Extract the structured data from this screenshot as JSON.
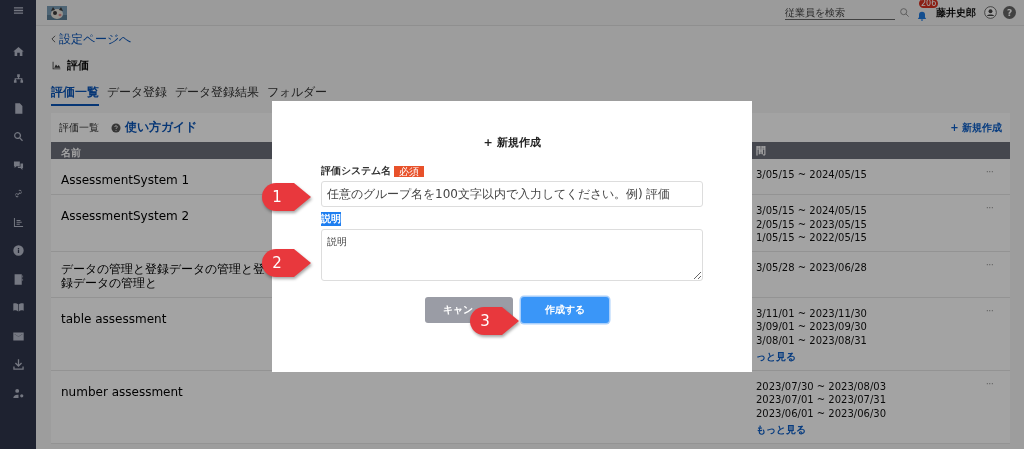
{
  "sidebar": {
    "items": [
      {
        "kind": "menu"
      },
      {
        "kind": "home"
      },
      {
        "kind": "sitemap"
      },
      {
        "kind": "document"
      },
      {
        "kind": "search"
      },
      {
        "kind": "chat"
      },
      {
        "kind": "link"
      },
      {
        "kind": "chart"
      },
      {
        "kind": "info"
      },
      {
        "kind": "contact"
      },
      {
        "kind": "book"
      },
      {
        "kind": "mail"
      },
      {
        "kind": "download"
      },
      {
        "kind": "user-settings"
      }
    ]
  },
  "header": {
    "search": {
      "placeholder": "従業員を検索"
    },
    "notification_count": "206",
    "user_name": "藤井史郎",
    "help": "?"
  },
  "breadcrumb": "設定ページへ",
  "page_title": "評価",
  "tabs": [
    {
      "label": "評価一覧",
      "selected": true
    },
    {
      "label": "データ登録",
      "selected": false
    },
    {
      "label": "データ登録結果",
      "selected": false
    },
    {
      "label": "フォルダー",
      "selected": false
    }
  ],
  "card": {
    "title": "評価一覧",
    "guide_link": "使い方ガイド",
    "new_button": "+ 新規作成"
  },
  "table": {
    "columns": [
      "名前",
      "間"
    ],
    "rows": [
      {
        "name": "AssessmentSystem 1",
        "periods": [
          "3/05/15 ~ 2024/05/15"
        ],
        "menu": "···"
      },
      {
        "name": "AssessmentSystem 2",
        "periods": [
          "3/05/15 ~ 2024/05/15",
          "2/05/15 ~ 2023/05/15",
          "1/05/15 ~ 2022/05/15"
        ],
        "menu": "···"
      },
      {
        "name": "データの管理と登録データの管理と登録データの管理と",
        "periods": [
          "3/05/28 ~ 2023/06/28"
        ],
        "menu": "···"
      },
      {
        "name": "table assessment",
        "periods": [
          "3/11/01 ~ 2023/11/30",
          "3/09/01 ~ 2023/09/30",
          "3/08/01 ~ 2023/08/31"
        ],
        "more": "っと見る",
        "menu": "···"
      },
      {
        "name": "number assessment",
        "periods": [
          "2023/07/30 ~ 2023/08/03",
          "2023/07/01 ~ 2023/07/31",
          "2023/06/01 ~ 2023/06/30"
        ],
        "more": "もっと見る",
        "menu": "···"
      }
    ]
  },
  "modal": {
    "title": "+ 新規作成",
    "name_label": "評価システム名",
    "required_badge": "必須",
    "name_placeholder": "任意のグループ名を100文字以内で入力してください。例) 評価",
    "description_label": {
      "text": "説明",
      "highlighted": true
    },
    "description_placeholder": "説明",
    "cancel_button": "キャン",
    "create_button": "作成する"
  },
  "callouts": [
    "1",
    "2",
    "3"
  ]
}
